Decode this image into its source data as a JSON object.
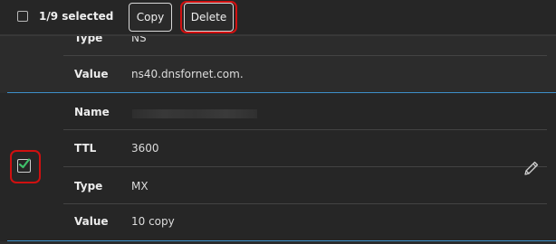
{
  "toolbar": {
    "selection_text": "1/9 selected",
    "copy_label": "Copy",
    "delete_label": "Delete"
  },
  "records": [
    {
      "selected": false,
      "fields": [
        {
          "label": "Type",
          "value": "NS"
        },
        {
          "label": "Value",
          "value": "ns40.dnsfornet.com."
        }
      ]
    },
    {
      "selected": true,
      "fields": [
        {
          "label": "Name",
          "value": ""
        },
        {
          "label": "TTL",
          "value": "3600"
        },
        {
          "label": "Type",
          "value": "MX"
        },
        {
          "label": "Value",
          "value": "10 copy"
        }
      ]
    }
  ],
  "icons": {
    "row_select": "checkbox-checked-icon",
    "edit": "pencil-icon"
  },
  "colors": {
    "accent_blue": "#3d8fc9",
    "check_green": "#3fbf6a",
    "highlight_red": "#d01010"
  }
}
